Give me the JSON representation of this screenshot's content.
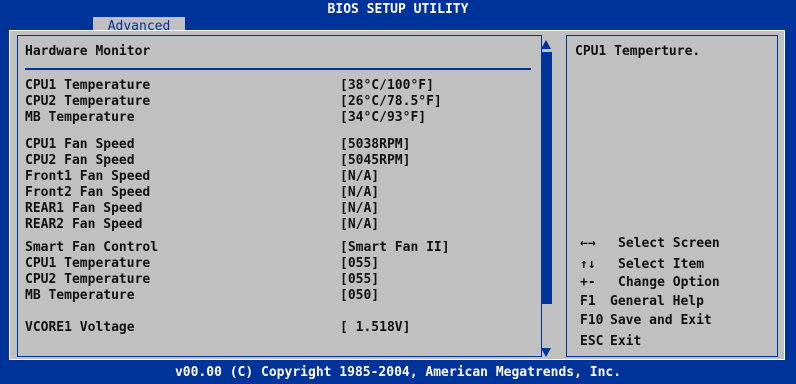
{
  "window": {
    "title": "BIOS SETUP UTILITY",
    "tab": "Advanced"
  },
  "section": {
    "title": "Hardware Monitor"
  },
  "rows": [
    {
      "label": "CPU1 Temperature",
      "value": "[38°C/100°F]"
    },
    {
      "label": "CPU2 Temperature",
      "value": "[26°C/78.5°F]"
    },
    {
      "label": "MB Temperature",
      "value": "[34°C/93°F]"
    },
    {
      "label": "CPU1 Fan Speed",
      "value": "[5038RPM]"
    },
    {
      "label": "CPU2 Fan Speed",
      "value": "[5045RPM]"
    },
    {
      "label": "Front1 Fan Speed",
      "value": "[N/A]"
    },
    {
      "label": "Front2 Fan Speed",
      "value": "[N/A]"
    },
    {
      "label": "REAR1 Fan Speed",
      "value": "[N/A]"
    },
    {
      "label": "REAR2 Fan Speed",
      "value": "[N/A]"
    },
    {
      "label": "Smart Fan Control",
      "value": "[Smart Fan II]"
    },
    {
      "label": "CPU1 Temperature",
      "value": "[055]"
    },
    {
      "label": "CPU2 Temperature",
      "value": "[055]"
    },
    {
      "label": "MB Temperature",
      "value": "[050]"
    },
    {
      "label": "VCORE1 Voltage",
      "value": "[ 1.518V]"
    }
  ],
  "help": {
    "text": "CPU1 Temperture."
  },
  "legend": [
    {
      "key": "←→",
      "label": "Select Screen"
    },
    {
      "key": "↑↓",
      "label": "Select Item"
    },
    {
      "key": "+-",
      "label": "Change Option"
    },
    {
      "key": "F1",
      "label": "General Help"
    },
    {
      "key": "F10",
      "label": "Save and Exit"
    },
    {
      "key": "ESC",
      "label": "Exit"
    }
  ],
  "footer": {
    "text": "v00.00 (C) Copyright 1985-2004, American Megatrends, Inc."
  },
  "colors": {
    "background": "#003399",
    "panel": "#c0c0c0",
    "text": "#111111",
    "highlight": "#ffffff"
  }
}
